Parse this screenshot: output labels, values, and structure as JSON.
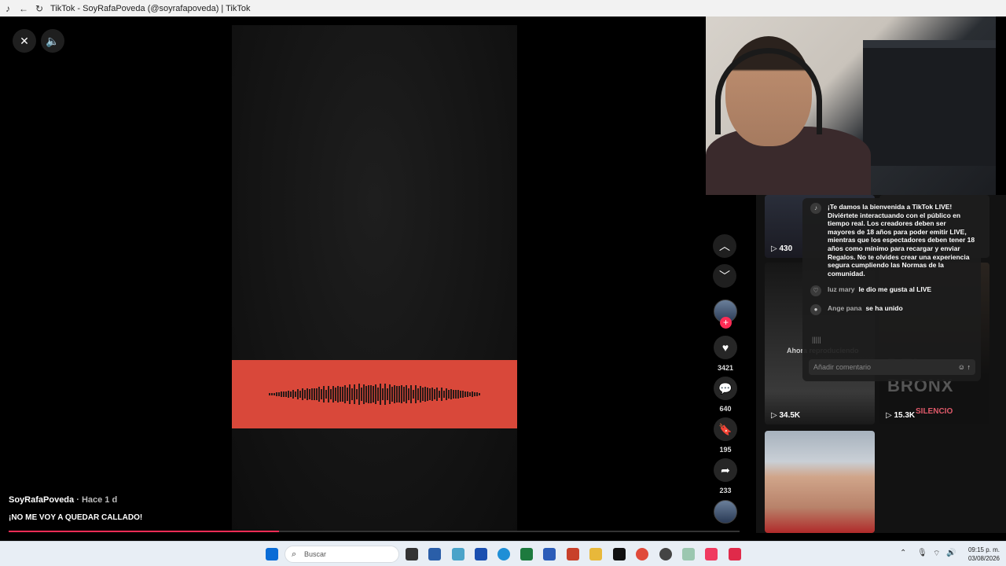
{
  "window": {
    "title": "TikTok - SoyRafaPoveda (@soyrafapoveda) | TikTok"
  },
  "video": {
    "author": "SoyRafaPoveda",
    "time_sep": " · ",
    "time": "Hace 1 d",
    "caption": "¡NO ME VOY A QUEDAR CALLADO!",
    "progress_fraction": 0.37
  },
  "actions": {
    "likes": "3421",
    "comments": "640",
    "saves": "195",
    "shares": "233"
  },
  "related": [
    {
      "views": "430"
    },
    {
      "views": "34.5K"
    },
    {
      "views": "15.3K"
    }
  ],
  "related_overlay": {
    "now_playing": "Ahora reproduciendo",
    "brand_text": "DEL BRONX",
    "brand_text2": "SILENCIO"
  },
  "chat": {
    "welcome": "¡Te damos la bienvenida a TikTok LIVE! Diviértete interactuando con el público en tiempo real. Los creadores deben ser mayores de 18 años para poder emitir LIVE, mientras que los espectadores deben tener 18 años como mínimo para recargar y enviar Regalos. No te olvides crear una experiencia segura cumpliendo las Normas de la comunidad.",
    "messages": [
      {
        "user": "luz mary",
        "text": "le dio me gusta al LIVE"
      },
      {
        "user": "Ange pana",
        "text": "se ha unido"
      }
    ],
    "input_placeholder": "Añadir comentario"
  },
  "taskbar": {
    "search_placeholder": "Buscar",
    "time": "09:15 p. m.",
    "date": "03/08/2026"
  },
  "colors": {
    "accent": "#fe2c55",
    "band": "#d9483a"
  }
}
